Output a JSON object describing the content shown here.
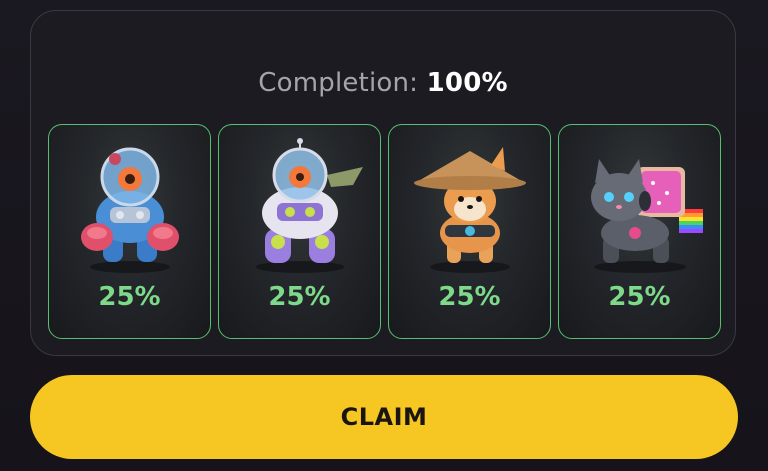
{
  "completion": {
    "label": "Completion:",
    "value": "100%"
  },
  "cards": [
    {
      "icon": "robot-diver-icon",
      "percent": "25%"
    },
    {
      "icon": "purple-mech-robot-icon",
      "percent": "25%"
    },
    {
      "icon": "shiba-straw-hat-icon",
      "percent": "25%"
    },
    {
      "icon": "robot-cat-rainbow-icon",
      "percent": "25%"
    }
  ],
  "claim_button": {
    "label": "CLAIM"
  },
  "colors": {
    "accent_yellow": "#f6c623",
    "card_border": "#55c06d",
    "percent_green": "#7fd98a"
  }
}
